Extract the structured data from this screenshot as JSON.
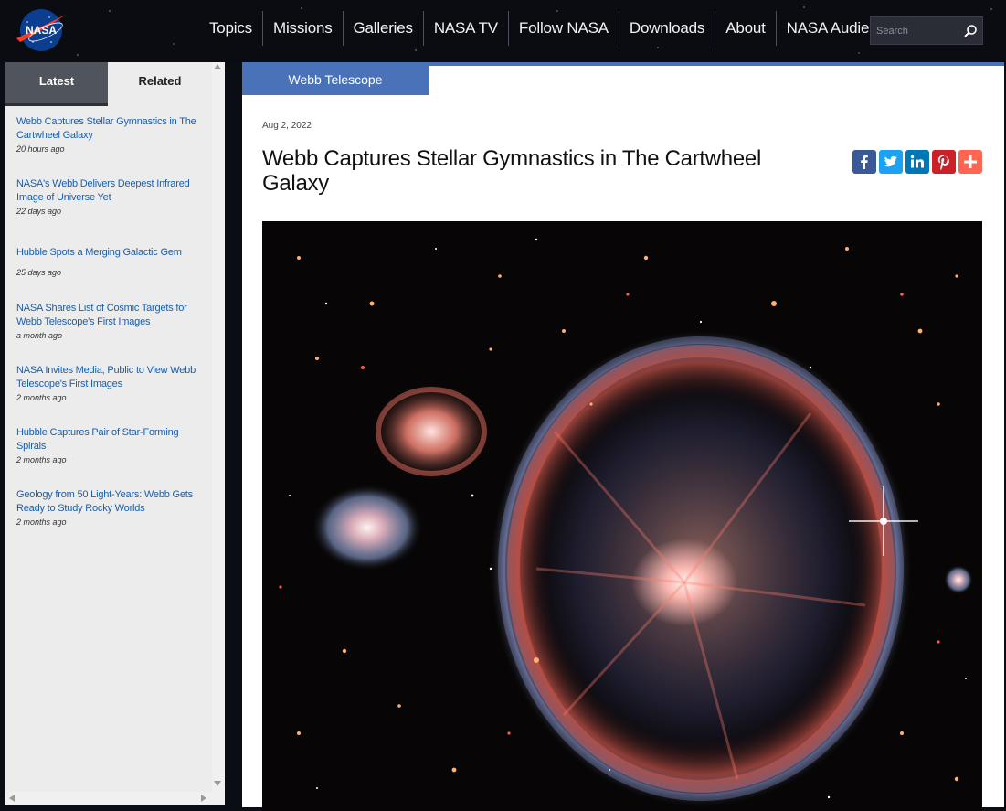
{
  "header": {
    "logo_text": "NASA",
    "nav": [
      {
        "label": "Topics"
      },
      {
        "label": "Missions"
      },
      {
        "label": "Galleries"
      },
      {
        "label": "NASA TV"
      },
      {
        "label": "Follow NASA"
      },
      {
        "label": "Downloads"
      },
      {
        "label": "About"
      },
      {
        "label": "NASA Audiences"
      }
    ],
    "search": {
      "placeholder": "Search",
      "icon": "magnifier-icon"
    }
  },
  "sidebar": {
    "tabs": [
      {
        "label": "Latest",
        "active": true
      },
      {
        "label": "Related",
        "active": false
      }
    ],
    "items": [
      {
        "title": "Webb Captures Stellar Gymnastics in The Cartwheel Galaxy",
        "time": "20 hours ago"
      },
      {
        "title": "NASA's Webb Delivers Deepest Infrared Image of Universe Yet",
        "time": "22 days ago"
      },
      {
        "title": "Hubble Spots a Merging Galactic Gem",
        "time": "25 days ago"
      },
      {
        "title": "NASA Shares List of Cosmic Targets for Webb Telescope's First Images",
        "time": "a month ago"
      },
      {
        "title": "NASA Invites Media, Public to View Webb Telescope's First Images",
        "time": "2 months ago"
      },
      {
        "title": "Hubble Captures Pair of Star-Forming Spirals",
        "time": "2 months ago"
      },
      {
        "title": "Geology from 50 Light-Years: Webb Gets Ready to Study Rocky Worlds",
        "time": "2 months ago"
      }
    ]
  },
  "article": {
    "category": "Webb Telescope",
    "date": "Aug 2, 2022",
    "title": "Webb Captures Stellar Gymnastics in The Cartwheel Galaxy",
    "share": [
      {
        "name": "facebook",
        "icon": "facebook-icon",
        "color": "#3b5998"
      },
      {
        "name": "twitter",
        "icon": "twitter-icon",
        "color": "#1da1f2"
      },
      {
        "name": "linkedin",
        "icon": "linkedin-icon",
        "color": "#0077b5"
      },
      {
        "name": "pinterest",
        "icon": "pinterest-icon",
        "color": "#cb2027"
      },
      {
        "name": "more",
        "icon": "plus-icon",
        "color": "#ff6550"
      }
    ],
    "image": {
      "subject": "cartwheel-galaxy"
    }
  },
  "colors": {
    "accent": "#4a72b8",
    "link": "#1a5ea8",
    "tab_active": "#50545c"
  }
}
